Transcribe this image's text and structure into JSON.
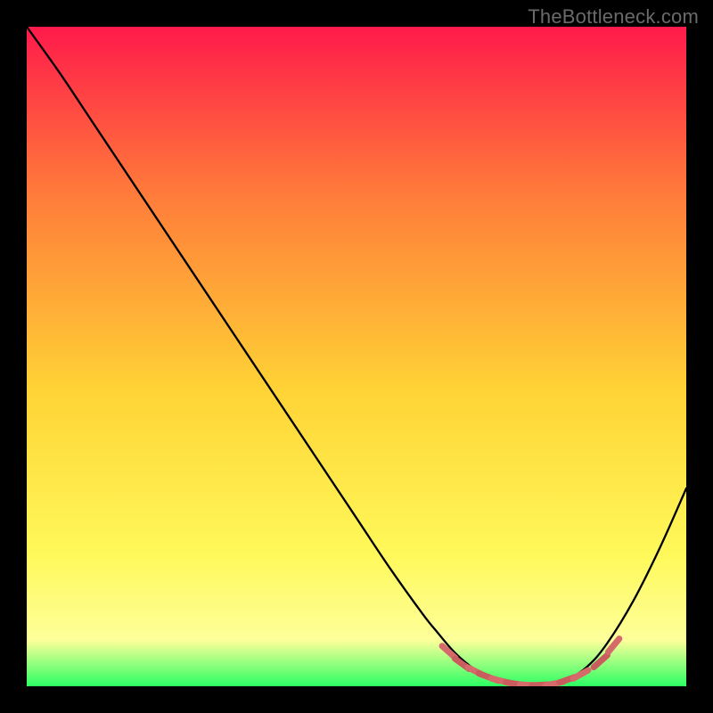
{
  "attribution": "TheBottleneck.com",
  "colors": {
    "bg": "#000000",
    "grad_top": "#ff1a4b",
    "grad_mid_upper": "#ff7a3a",
    "grad_mid": "#ffd335",
    "grad_mid_lower": "#fff95a",
    "grad_low": "#fdff9a",
    "grad_bottom": "#2cff63",
    "curve": "#000000",
    "marker": "#d66a6a",
    "marker_alt": "#c95d5d"
  },
  "chart_data": {
    "type": "line",
    "title": "",
    "xlabel": "",
    "ylabel": "",
    "xlim": [
      0,
      100
    ],
    "ylim": [
      0,
      100
    ],
    "grid": false,
    "series": [
      {
        "name": "bottleneck-curve",
        "x": [
          0,
          5,
          10,
          15,
          20,
          25,
          30,
          35,
          40,
          45,
          50,
          55,
          60,
          62,
          65,
          68,
          70,
          72,
          74,
          76,
          78,
          80,
          82,
          85,
          88,
          92,
          96,
          100
        ],
        "y": [
          100,
          93,
          85.5,
          78,
          70.5,
          63,
          55.5,
          48,
          40.5,
          33,
          25.5,
          18,
          11,
          8.5,
          5,
          2.5,
          1.5,
          0.8,
          0.4,
          0.2,
          0.2,
          0.4,
          1,
          3,
          6.5,
          13,
          21,
          30
        ]
      }
    ],
    "markers": {
      "name": "optimal-band",
      "x": [
        64,
        66,
        68,
        70,
        72,
        74,
        76,
        78,
        80,
        82,
        84,
        87,
        89
      ],
      "y": [
        5.2,
        3.4,
        2.3,
        1.4,
        0.8,
        0.4,
        0.2,
        0.2,
        0.4,
        1.0,
        1.8,
        3.8,
        6.2
      ]
    }
  }
}
